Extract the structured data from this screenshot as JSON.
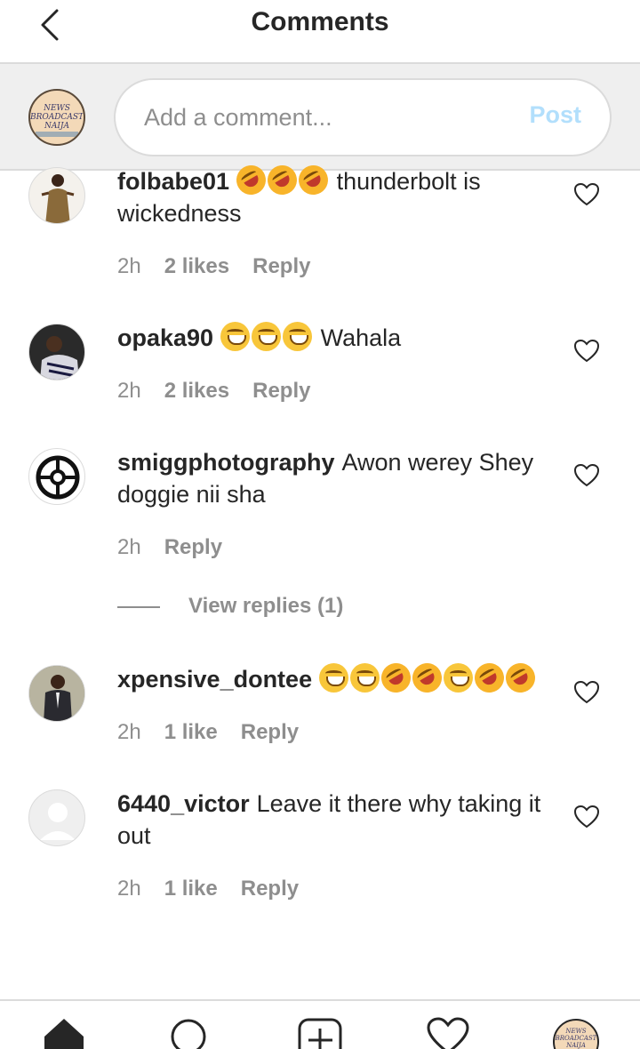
{
  "header": {
    "title": "Comments"
  },
  "compose": {
    "avatar_text": "NEWS BROADCAST NAIJA",
    "placeholder": "Add a comment...",
    "post_label": "Post"
  },
  "comments": [
    {
      "username": "folbabe01",
      "emojis": [
        "rofl",
        "rofl",
        "rofl"
      ],
      "text": "thunderbolt is wickedness",
      "time": "2h",
      "likes": "2 likes",
      "reply": "Reply"
    },
    {
      "username": "opaka90",
      "emojis": [
        "laugh",
        "laugh",
        "laugh"
      ],
      "text": "Wahala",
      "time": "2h",
      "likes": "2 likes",
      "reply": "Reply"
    },
    {
      "username": "smiggphotography",
      "emojis": [],
      "text": "Awon werey Shey doggie nii sha",
      "time": "2h",
      "likes": "",
      "reply": "Reply",
      "view_replies": "View replies (1)"
    },
    {
      "username": "xpensive_dontee",
      "emojis": [
        "laugh",
        "laugh",
        "rofl",
        "rofl",
        "laugh",
        "rofl",
        "rofl"
      ],
      "text": "",
      "time": "2h",
      "likes": "1 like",
      "reply": "Reply"
    },
    {
      "username": "6440_victor",
      "emojis": [],
      "text": "Leave it there why taking it out",
      "time": "2h",
      "likes": "1 like",
      "reply": "Reply"
    }
  ],
  "bottom_nav": {
    "icons": [
      "home-icon",
      "search-icon",
      "add-post-icon",
      "activity-heart-icon",
      "profile-avatar"
    ],
    "avatar_text": "NEWS BROADCAST NAIJA"
  }
}
